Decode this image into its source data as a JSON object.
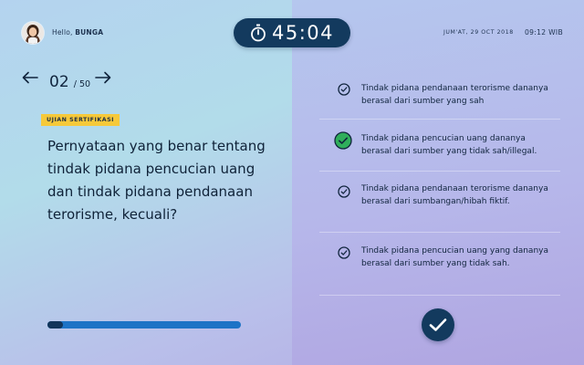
{
  "header": {
    "greeting": "Hello, ",
    "username": "BUNGA",
    "timer": "45:04",
    "date": "JUM'AT, 29 OCT 2018",
    "time": "09:12 WIB"
  },
  "question": {
    "current": "02",
    "total": "/ 50",
    "badge": "UJIAN SERTIFIKASI",
    "text": "Pernyataan yang benar tentang tindak pidana pencucian uang dan tindak pidana pendanaan terorisme, kecuali?",
    "progress_fraction": 0.08
  },
  "options": [
    {
      "text": "Tindak pidana pendanaan terorisme dananya berasal dari sumber yang sah",
      "selected": false
    },
    {
      "text": "Tindak pidana pencucian uang dananya berasal dari sumber yang tidak sah/illegal.",
      "selected": true
    },
    {
      "text": "Tindak pidana pendanaan terorisme dananya berasal dari sumbangan/hibah fiktif.",
      "selected": false
    },
    {
      "text": "Tindak pidana pencucian uang yang dananya berasal dari sumber yang tidak sah.",
      "selected": false
    }
  ],
  "colors": {
    "navy": "#133a5e",
    "badge": "#f6c93a",
    "progress": "#1d73c6",
    "selected_check": "#2fae5b"
  },
  "icons": [
    "stopwatch-icon",
    "arrow-left-icon",
    "arrow-right-icon",
    "check-circle-icon",
    "submit-check-icon"
  ]
}
